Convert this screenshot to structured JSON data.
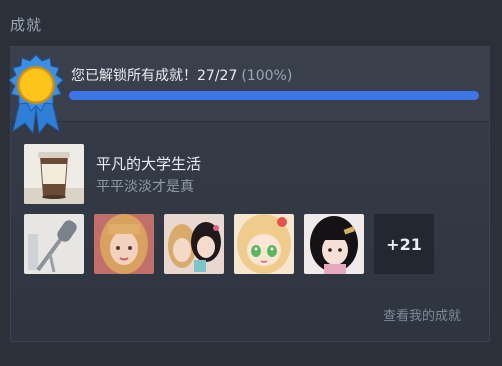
{
  "section": {
    "title": "成就"
  },
  "progress": {
    "message": "您已解锁所有成就！27/27",
    "percent_text": "(100%)",
    "fraction": 1.0,
    "bar_color": "#3d74e8"
  },
  "game": {
    "name": "平凡的大学生活",
    "subtitle": "平平淡淡才是真",
    "thumb_icon": "coffee-cup-icon"
  },
  "achievements": {
    "icons": [
      "microphone-icon",
      "portrait-blonde-girl",
      "portrait-two-girls",
      "anime-girl-portrait",
      "portrait-dark-hair-girl"
    ],
    "more_label": "+21"
  },
  "footer": {
    "view_link": "查看我的成就"
  }
}
